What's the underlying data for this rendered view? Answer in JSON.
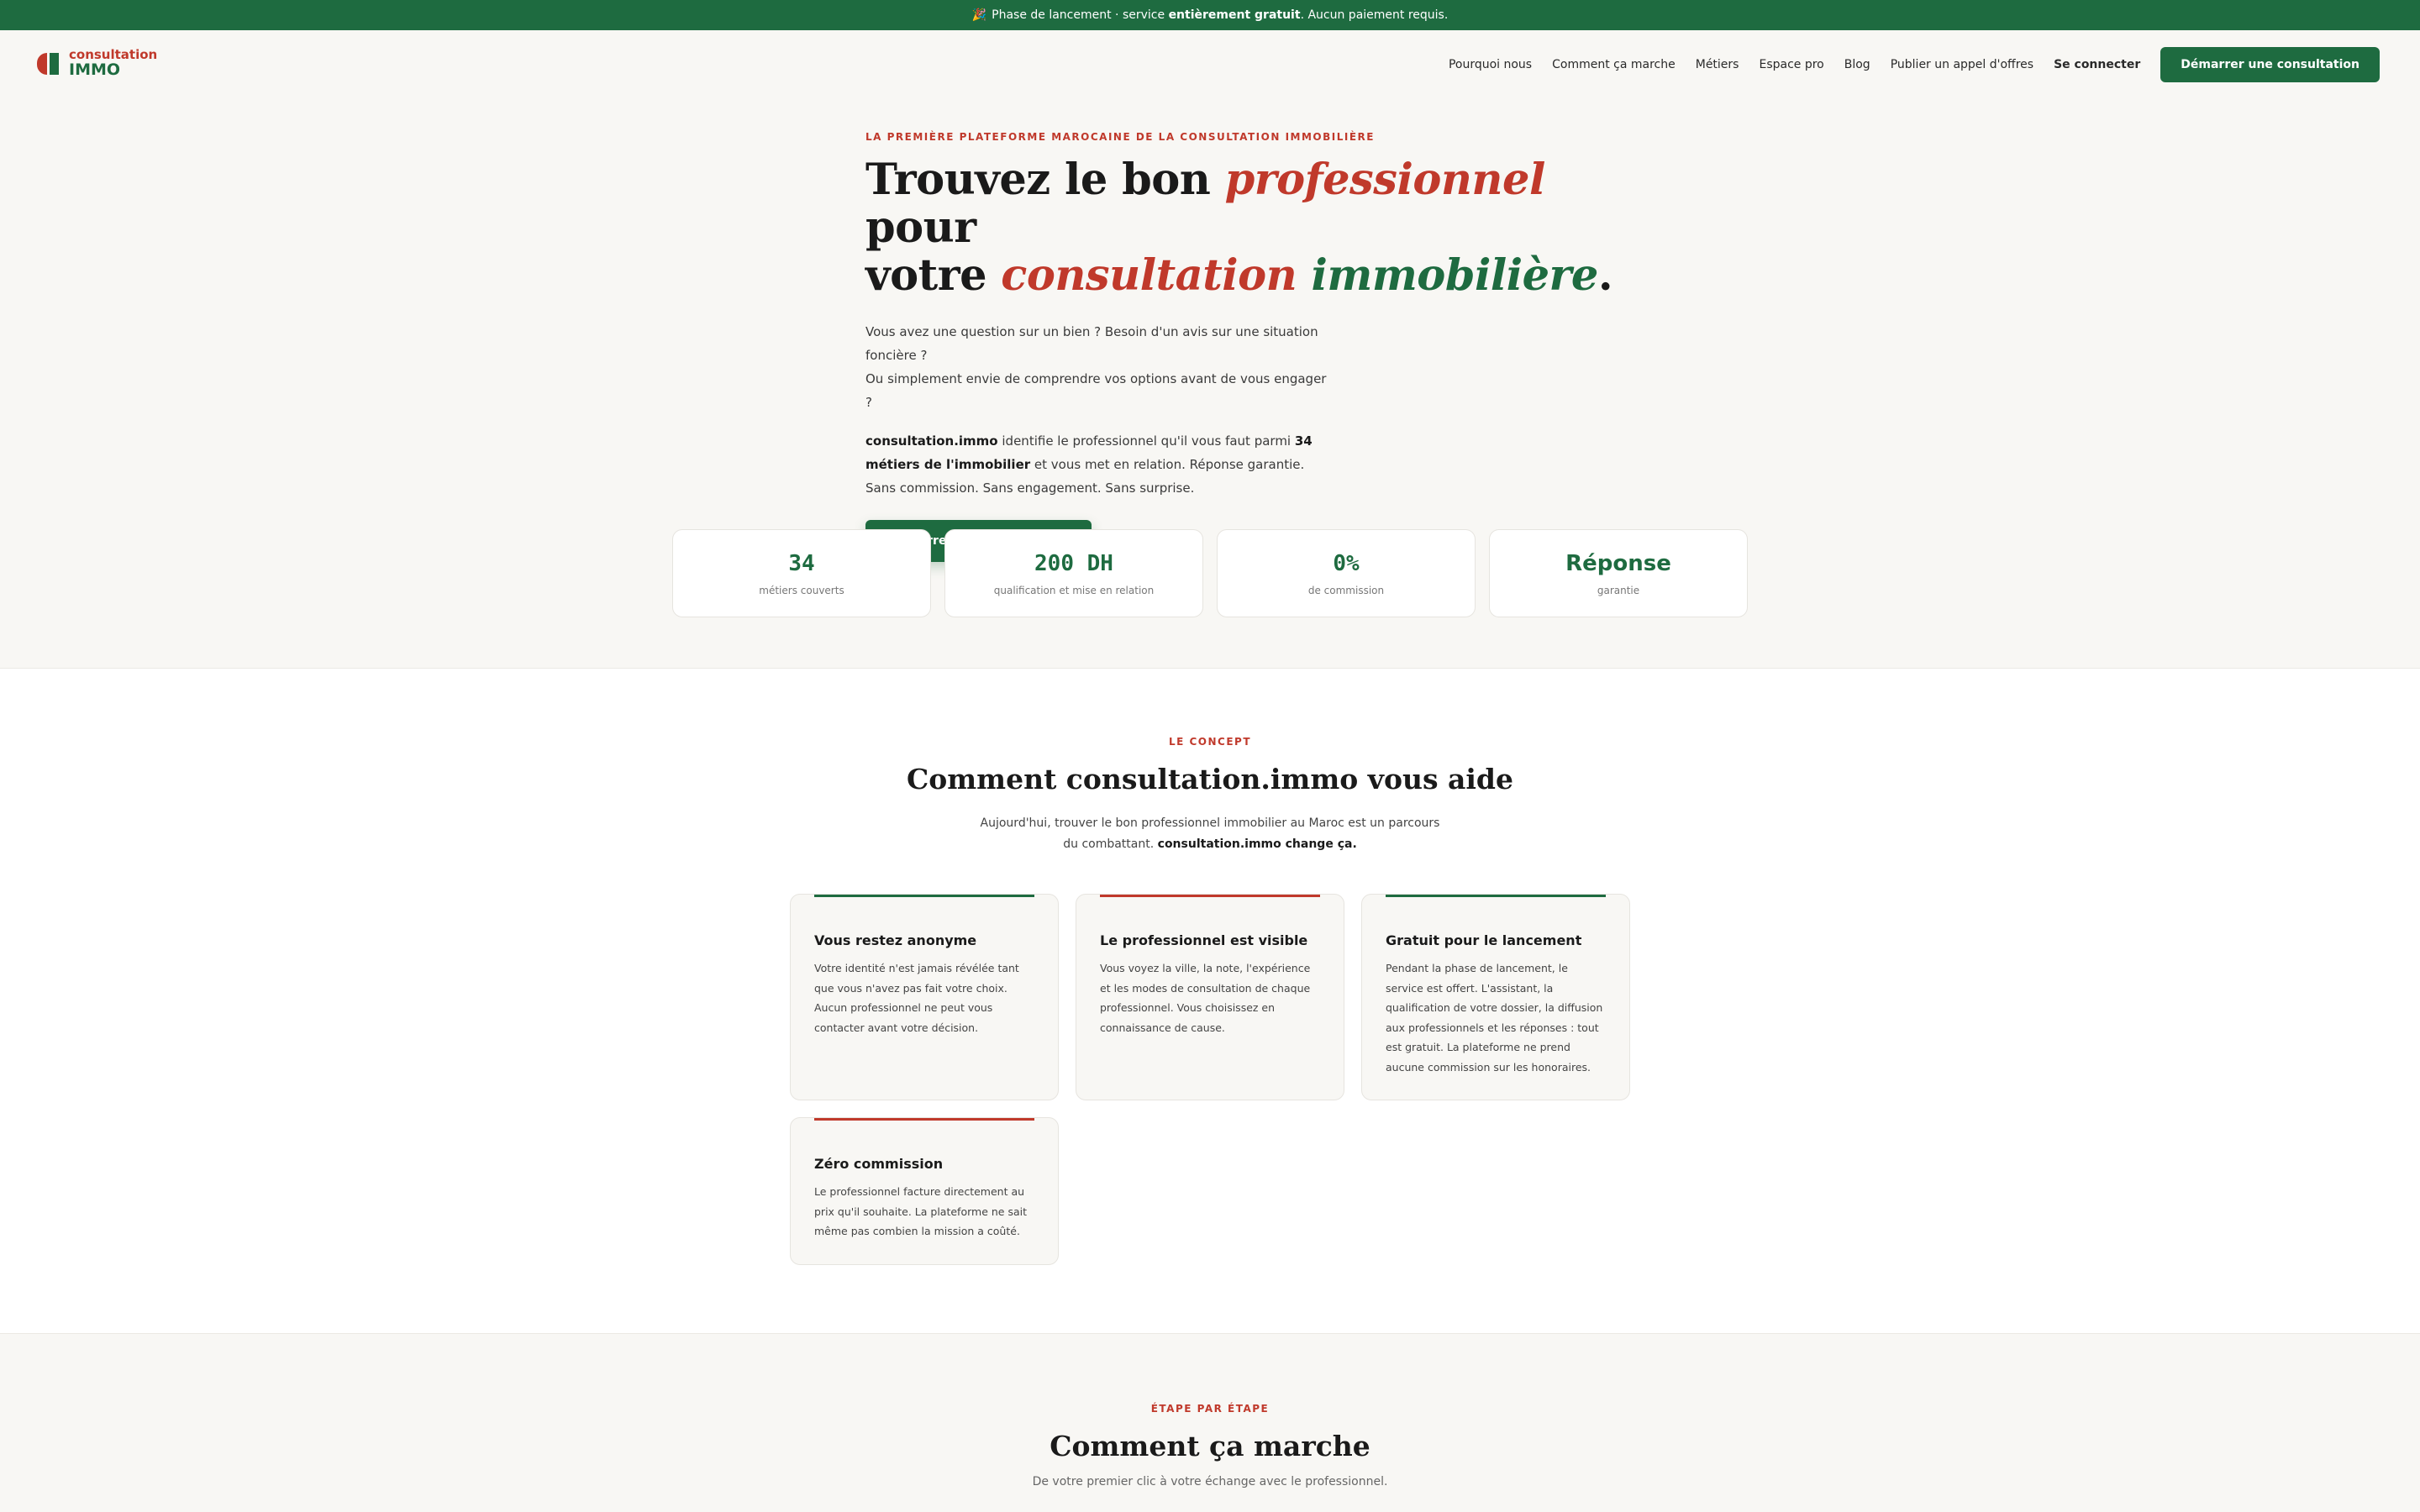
{
  "banner": {
    "emoji": "🎉",
    "before": "Phase de lancement · service",
    "bold": "entièrement gratuit",
    "after": ". Aucun paiement requis."
  },
  "logo": {
    "line1": "consultation",
    "line2": "IMMO"
  },
  "nav": {
    "links": [
      "Pourquoi nous",
      "Comment ça marche",
      "Métiers",
      "Espace pro",
      "Blog",
      "Publier un appel d'offres"
    ],
    "login": "Se connecter",
    "cta": "Démarrer une consultation"
  },
  "hero": {
    "eyebrow": "LA PREMIÈRE PLATEFORME MAROCAINE DE LA CONSULTATION IMMOBILIÈRE",
    "title_a": "Trouvez le bon ",
    "title_b": "professionnel",
    "title_c": " pour",
    "title_d": "votre ",
    "title_e": "consultation",
    "title_f": "immobilière",
    "title_g": ".",
    "p1_line1": "Vous avez une question sur un bien ? Besoin d'un avis sur une situation foncière ?",
    "p1_line2": "Ou simplement envie de comprendre vos options avant de vous engager ?",
    "p2_bold1": "consultation.immo",
    "p2_text1": " identifie le professionnel qu'il vous faut parmi ",
    "p2_bold2": "34 métiers de l'immobilier",
    "p2_text2": " et vous met en relation. Réponse garantie. Sans commission. Sans engagement. Sans surprise.",
    "cta": "Démarrer une consultation"
  },
  "stats": [
    {
      "value": "34",
      "label": "métiers couverts"
    },
    {
      "value": "200 DH",
      "label": "qualification et mise en relation"
    },
    {
      "value": "0%",
      "label": "de commission"
    },
    {
      "value": "Réponse",
      "label": "garantie"
    }
  ],
  "concept": {
    "eyebrow": "LE CONCEPT",
    "title": "Comment consultation.immo vous aide",
    "lead_text": "Aujourd'hui, trouver le bon professionnel immobilier au Maroc est un parcours du combattant. ",
    "lead_bold": "consultation.immo change ça.",
    "cards": [
      {
        "title": "Vous restez anonyme",
        "text": "Votre identité n'est jamais révélée tant que vous n'avez pas fait votre choix. Aucun professionnel ne peut vous contacter avant votre décision.",
        "accent": "#1e6b40"
      },
      {
        "title": "Le professionnel est visible",
        "text": "Vous voyez la ville, la note, l'expérience et les modes de consultation de chaque professionnel. Vous choisissez en connaissance de cause.",
        "accent": "#c0392b"
      },
      {
        "title": "Gratuit pour le lancement",
        "text": "Pendant la phase de lancement, le service est offert. L'assistant, la qualification de votre dossier, la diffusion aux professionnels et les réponses : tout est gratuit. La plateforme ne prend aucune commission sur les honoraires.",
        "accent": "#1e6b40"
      },
      {
        "title": "Zéro commission",
        "text": "Le professionnel facture directement au prix qu'il souhaite. La plateforme ne sait même pas combien la mission a coûté.",
        "accent": "#c0392b"
      }
    ]
  },
  "steps": {
    "eyebrow": "ÉTAPE PAR ÉTAPE",
    "title": "Comment ça marche",
    "lead": "De votre premier clic à votre échange avec le professionnel."
  }
}
